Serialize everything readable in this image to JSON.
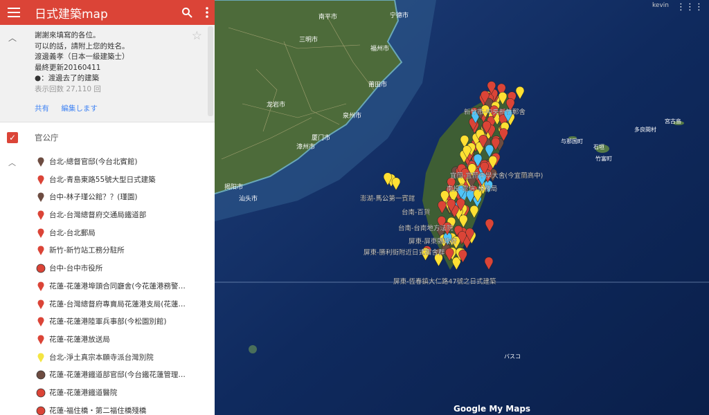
{
  "topbar": {
    "title": "日式建築map",
    "menu_icon": "menu-icon",
    "search_icon": "search-icon",
    "more_icon": "more-vert-icon"
  },
  "info": {
    "description": "謝謝來填寫的各位。\n可以的話，請附上您的姓名。\n渡邊義孝（日本一級建築士）\n最終更新20160411\n●：渡邊去了的建築",
    "views": "表示回数 27,110 回",
    "share": "共有",
    "edit": "編集します"
  },
  "layer": {
    "name": "官公庁",
    "checked": true
  },
  "items": [
    {
      "label": "台北-總督官邸(今台北賓館)",
      "icon": "pin",
      "color": "#6d4c41"
    },
    {
      "label": "台北-青島東路55號大型日式建築",
      "icon": "pin",
      "color": "#db4437"
    },
    {
      "label": "台中-林子瑾公館？？(瑾園)",
      "icon": "pin",
      "color": "#6d4c41"
    },
    {
      "label": "台北-台灣總督府交通局鐵道部",
      "icon": "pin",
      "color": "#db4437"
    },
    {
      "label": "台北-台北郵局",
      "icon": "pin",
      "color": "#db4437"
    },
    {
      "label": "新竹-新竹站工務分駐所",
      "icon": "pin",
      "color": "#db4437"
    },
    {
      "label": "台中-台中市役所",
      "icon": "dot",
      "color": "#db4437"
    },
    {
      "label": "花蓮-花蓮港埠頭合同廳舍(今花蓮港務警…",
      "icon": "pin",
      "color": "#db4437"
    },
    {
      "label": "花蓮-台灣總督府專賣局花蓮港支局(花蓮…",
      "icon": "pin",
      "color": "#db4437"
    },
    {
      "label": "花蓮-花蓮港陸軍兵事部(今松園別館)",
      "icon": "pin",
      "color": "#db4437"
    },
    {
      "label": "花蓮-花蓮港放送局",
      "icon": "pin",
      "color": "#db4437"
    },
    {
      "label": "台北-淨土真宗本願寺派台灣別院",
      "icon": "pin",
      "color": "#f4e542"
    },
    {
      "label": "花蓮-花蓮港鐵道部官邸(今台鐵花蓮管理…",
      "icon": "dot",
      "color": "#6d4c41"
    },
    {
      "label": "花蓮-花蓮港鐵道醫院",
      "icon": "dot",
      "color": "#db4437"
    },
    {
      "label": "花蓮-福住橋・第二福住橋殘橋",
      "icon": "dot",
      "color": "#db4437"
    }
  ],
  "map": {
    "user": "kevin",
    "cities": [
      "南平市",
      "宁德市",
      "三明市",
      "福州市",
      "莆田市",
      "龙岩市",
      "泉州市",
      "厦门市",
      "漳州市",
      "揭阳市",
      "汕头市"
    ],
    "islands": [
      "宮古島",
      "多良間村",
      "与那国町",
      "石垣",
      "竹富町",
      "バスコ"
    ],
    "pin_labels": [
      "新竹市-中央新竹郵舍",
      "宜蘭-宜蘭中學大舍(今宜蘭高中)",
      "南投-電信-林務局",
      "台南-百貨",
      "台南-台南地方法院",
      "屏東-屏東縣政府",
      "屏東-勝利街附近日式宿舍群",
      "屏東-恆春鎮大仁路47號之日式建築",
      "澎湖-馬公第一賓館"
    ],
    "logo": "Google My Maps",
    "colors": {
      "red": "#db4437",
      "yellow": "#ffe033",
      "brown": "#6d4c41",
      "blue": "#4fc3f7"
    }
  }
}
